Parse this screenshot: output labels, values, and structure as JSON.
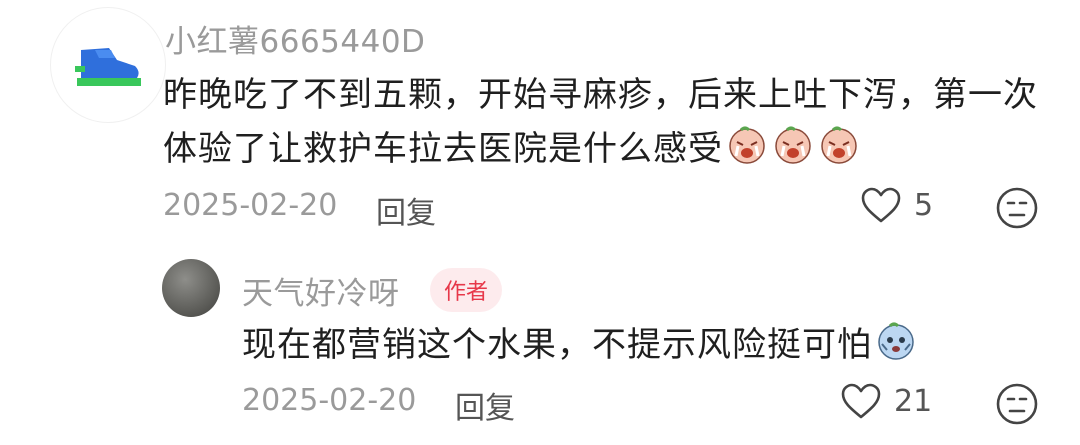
{
  "comments": [
    {
      "username": "小红薯6665440D",
      "text_line1": "昨晚吃了不到五颗，开始寻麻疹，后来上吐下泻，第一次",
      "text_line2": "体验了让救护车拉去医院是什么感受",
      "emoji": [
        "crying-face",
        "crying-face",
        "crying-face"
      ],
      "date": "2025-02-20",
      "reply_label": "回复",
      "like_count": "5"
    },
    {
      "username": "天气好冷呀",
      "badge": "作者",
      "text": "现在都营销这个水果，不提示风险挺可怕",
      "emoji": [
        "scared-face"
      ],
      "date": "2025-02-20",
      "reply_label": "回复",
      "like_count": "21"
    }
  ],
  "colors": {
    "badge_bg": "#fdebed",
    "badge_text": "#e7384a",
    "muted": "#9a9a9a"
  }
}
